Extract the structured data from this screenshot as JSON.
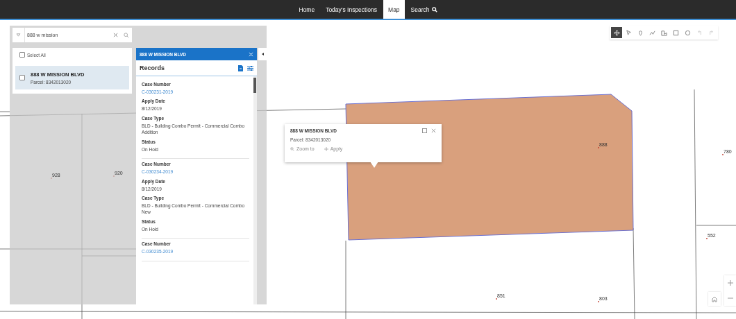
{
  "nav": {
    "items": [
      {
        "label": "Home",
        "selected": false
      },
      {
        "label": "Today's Inspections",
        "selected": false
      },
      {
        "label": "Map",
        "selected": true
      },
      {
        "label": "Search",
        "selected": false,
        "kind": "search"
      }
    ]
  },
  "search": {
    "value": "888 w mission"
  },
  "results": {
    "select_all": {
      "label": "Select All",
      "checked": false
    },
    "items": [
      {
        "title": "888 W MISSION BLVD",
        "parcel": "Parcel: 8342013020",
        "checked": false,
        "selected": true
      }
    ]
  },
  "records_panel": {
    "title": "888 W MISSION BLVD",
    "heading": "Records",
    "records": [
      {
        "fields": [
          {
            "label": "Case Number",
            "value": "C-030231-2019",
            "kind": "link"
          },
          {
            "label": "Apply Date",
            "value": "8/12/2019",
            "kind": "text"
          },
          {
            "label": "Case Type",
            "value": "BLD - Building Combo Permit - Commercial Combo Addition",
            "kind": "text"
          },
          {
            "label": "Status",
            "value": "On Hold",
            "kind": "text"
          }
        ]
      },
      {
        "fields": [
          {
            "label": "Case Number",
            "value": "C-030234-2019",
            "kind": "link"
          },
          {
            "label": "Apply Date",
            "value": "8/12/2019",
            "kind": "text"
          },
          {
            "label": "Case Type",
            "value": "BLD - Building Combo Permit - Commercial Combo New",
            "kind": "text"
          },
          {
            "label": "Status",
            "value": "On Hold",
            "kind": "text"
          }
        ]
      },
      {
        "fields": [
          {
            "label": "Case Number",
            "value": "C-030235-2019",
            "kind": "link"
          }
        ]
      }
    ]
  },
  "popup": {
    "title": "888 W MISSION BLVD",
    "parcel": "Parcel: 8342013020",
    "actions": [
      {
        "label": "Zoom to",
        "kind": "zoom"
      },
      {
        "label": "Apply",
        "kind": "add"
      }
    ]
  },
  "toolbar": {
    "tools": [
      {
        "kind": "pan",
        "selected": true,
        "disabled": false
      },
      {
        "kind": "select",
        "selected": false,
        "disabled": false
      },
      {
        "kind": "point",
        "selected": false,
        "disabled": false
      },
      {
        "kind": "line",
        "selected": false,
        "disabled": false
      },
      {
        "kind": "polygon",
        "selected": false,
        "disabled": false
      },
      {
        "kind": "rectangle",
        "selected": false,
        "disabled": false
      },
      {
        "kind": "circle",
        "selected": false,
        "disabled": false
      },
      {
        "kind": "undo",
        "selected": false,
        "disabled": true
      },
      {
        "kind": "redo",
        "selected": false,
        "disabled": true
      }
    ]
  },
  "parcel_labels": [
    {
      "text": "928"
    },
    {
      "text": "920"
    },
    {
      "text": "888"
    },
    {
      "text": "780"
    },
    {
      "text": "552"
    },
    {
      "text": "851"
    },
    {
      "text": "803"
    }
  ]
}
